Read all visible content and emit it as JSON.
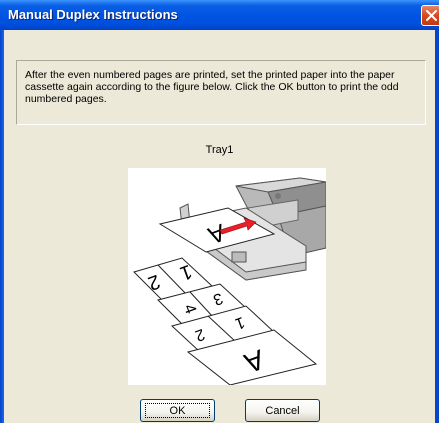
{
  "dialog": {
    "title": "Manual Duplex Instructions",
    "close_icon": "close-icon",
    "instructions": "After the even numbered pages are printed, set the printed paper into the paper cassette again according to the figure below. Click the OK button to print the odd numbered pages.",
    "tray_label": "Tray1",
    "figure": {
      "page_labels": [
        "A",
        "2",
        "1",
        "4",
        "3",
        "2",
        "1",
        "A"
      ],
      "arrow_color": "#e8202a"
    },
    "buttons": {
      "ok": "OK",
      "cancel": "Cancel"
    }
  },
  "colors": {
    "titlebar": "#0054e3",
    "dialog_bg": "#ece9d8",
    "close_button": "#d6481e"
  }
}
